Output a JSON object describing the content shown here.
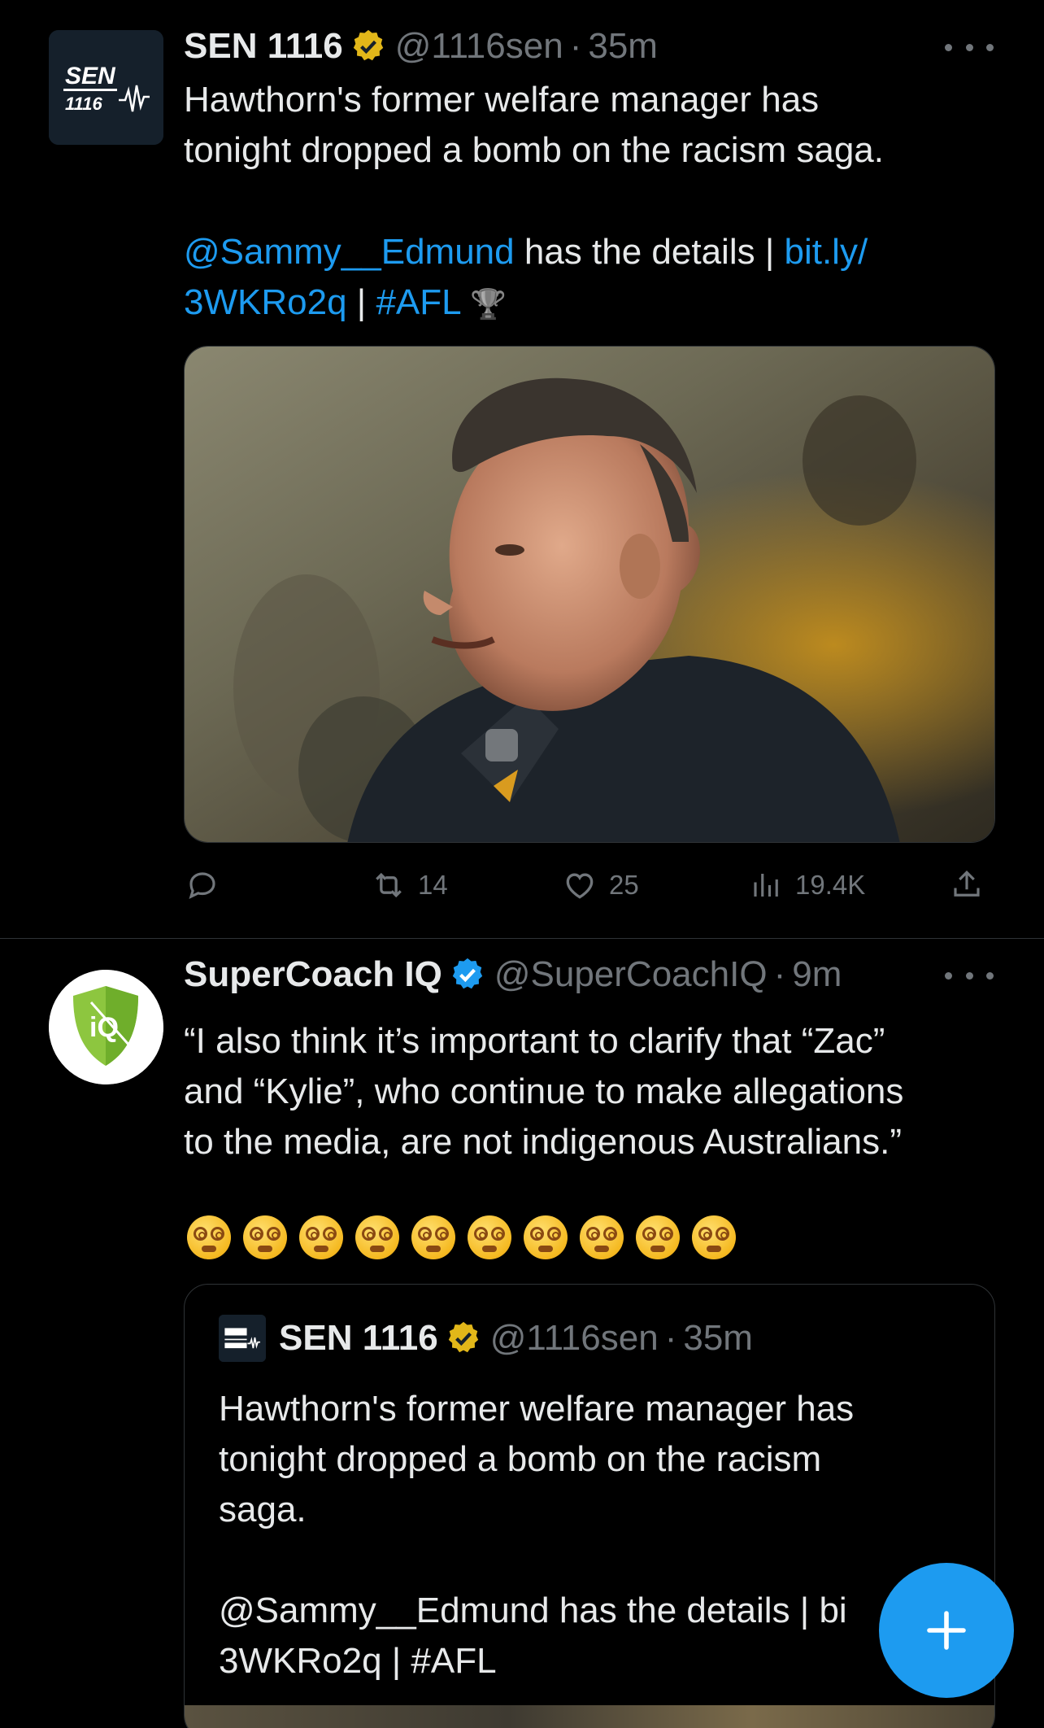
{
  "tweets": [
    {
      "name": "SEN 1116",
      "handle": "@1116sen",
      "separator": "·",
      "time": "35m",
      "avatar_text_top": "SEN",
      "avatar_text_bottom": "1116",
      "text_line1": "Hawthorn's former welfare manager has",
      "text_line2": "tonight dropped a bomb on the racism saga.",
      "mention": "@Sammy__Edmund",
      "mid_text": " has the details | ",
      "link_part1": "bit.ly/",
      "link_part2": "3WKRo2q",
      "pipe": " | ",
      "hashtag": "#AFL",
      "trophy": "🏆",
      "actions": {
        "reply_count": "",
        "retweet_count": "14",
        "like_count": "25",
        "views_count": "19.4K"
      }
    },
    {
      "name": "SuperCoach IQ",
      "handle": "@SuperCoachIQ",
      "separator": "·",
      "time": "9m",
      "avatar_text": "iQ",
      "text": "“I also think it’s important to clarify that “Zac”\nand “Kylie”, who continue to make allegations\nto the media, are not indigenous Australians.”",
      "emoji_count": 10,
      "quoted": {
        "name": "SEN 1116",
        "handle": "@1116sen",
        "separator": "·",
        "time": "35m",
        "text": "Hawthorn's former welfare manager has\ntonight dropped a bomb on the racism\nsaga.\n\n@Sammy__Edmund has the details | bi\n3WKRo2q | #AFL"
      }
    }
  ],
  "colors": {
    "background": "#000000",
    "text": "#e7e9ea",
    "muted": "#71767b",
    "link": "#1d9bf0",
    "divider": "#2f3336",
    "verified_gold": "#e2b719",
    "verified_blue": "#1d9bf0"
  },
  "icons": [
    "more-icon",
    "verified-gold-icon",
    "verified-blue-icon",
    "reply-icon",
    "retweet-icon",
    "like-icon",
    "views-icon",
    "share-icon",
    "compose-plus-icon"
  ]
}
